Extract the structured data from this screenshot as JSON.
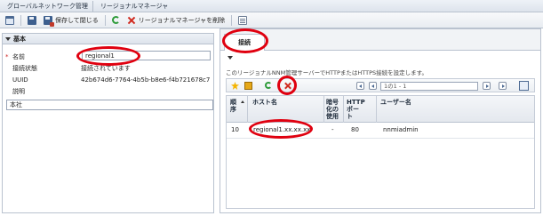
{
  "breadcrumb": {
    "items": [
      "グローバルネットワーク管理",
      "リージョナルマネージャ"
    ]
  },
  "toolbar": {
    "save_close_label": "保存して閉じる",
    "delete_label": "リージョナルマネージャを削除"
  },
  "basics": {
    "section_title": "基本",
    "name_label": "名前",
    "name_value": "regional1",
    "status_label": "接続状態",
    "status_value": "接続されています",
    "uuid_label": "UUID",
    "uuid_value": "42b674d6-7764-4b5b-b8e6-f4b721678c7",
    "description_label": "説明",
    "description_value": "本社"
  },
  "connection": {
    "tab_label": "接続",
    "description": "このリージョナルNNM管理サーバーでHTTPまたはHTTPS接続を設定します。",
    "pager_text": "1の1 - 1",
    "columns": [
      "順序",
      "ホスト名",
      "暗号化の使用",
      "HTTPポート",
      "ユーザー名"
    ],
    "rows": [
      {
        "order": "10",
        "hostname": "regional1.xx.xx.xx",
        "encryption": "-",
        "http_port": "80",
        "username": "nnmiadmin"
      }
    ]
  },
  "colors": {
    "highlight": "#e0000f",
    "toolbar_bg": "#e8ecf1",
    "border": "#b9c2cf"
  }
}
